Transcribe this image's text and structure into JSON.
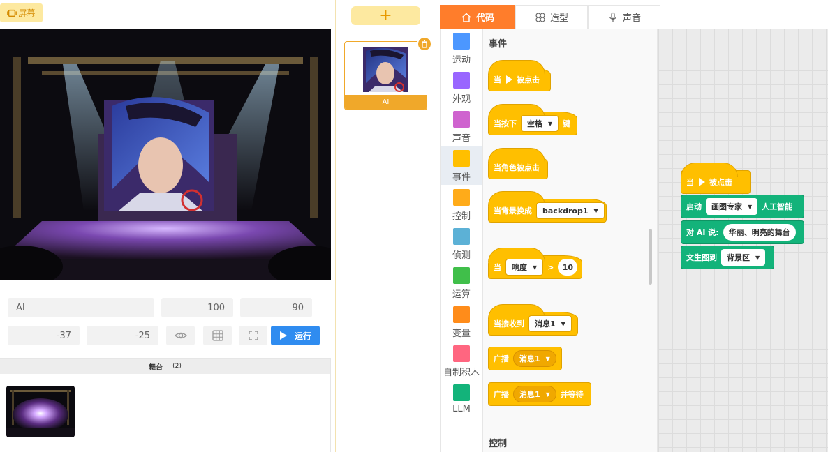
{
  "left": {
    "screen_label": "屏幕",
    "sprite_name_value": "AI",
    "size_value": "100",
    "direction_value": "90",
    "x_value": "-37",
    "y_value": "-25",
    "run_label": "运行",
    "stage_label": "舞台",
    "stage_count": "(2)"
  },
  "sprite": {
    "add_label": "+",
    "name": "AI"
  },
  "tabs": [
    {
      "label": "代码",
      "icon": "home-icon"
    },
    {
      "label": "造型",
      "icon": "costume-icon"
    },
    {
      "label": "声音",
      "icon": "microphone-icon"
    }
  ],
  "categories": [
    {
      "label": "运动",
      "color": "#4c97ff"
    },
    {
      "label": "外观",
      "color": "#9966ff"
    },
    {
      "label": "声音",
      "color": "#cf63cf"
    },
    {
      "label": "事件",
      "color": "#ffbf00"
    },
    {
      "label": "控制",
      "color": "#ffab19"
    },
    {
      "label": "侦测",
      "color": "#5cb1d6"
    },
    {
      "label": "运算",
      "color": "#40bf4a"
    },
    {
      "label": "变量",
      "color": "#ff8c1a"
    },
    {
      "label": "自制积木",
      "color": "#ff6680"
    },
    {
      "label": "LLM",
      "color": "#13b37a"
    }
  ],
  "palette": {
    "events_title": "事件",
    "control_title": "控制",
    "when_flag_a": "当",
    "when_flag_b": "被点击",
    "key_a": "当按下",
    "key_dd": "空格",
    "key_b": "键",
    "sprite_clicked": "当角色被点击",
    "backdrop_a": "当背景换成",
    "backdrop_dd": "backdrop1",
    "loud_a": "当",
    "loud_dd": "响度",
    "loud_op": ">",
    "loud_val": "10",
    "receive_a": "当接收到",
    "receive_dd": "消息1",
    "broadcast_a": "广播",
    "broadcast_dd": "消息1",
    "broadcast_wait_a": "广播",
    "broadcast_wait_dd": "消息1",
    "broadcast_wait_b": "并等待"
  },
  "workspace": {
    "hat_a": "当",
    "hat_b": "被点击",
    "start_a": "启动",
    "start_dd": "画图专家",
    "start_b": "人工智能",
    "say_a": "对 AI 说:",
    "say_val": "华丽、明亮的舞台",
    "t2i_a": "文生图到",
    "t2i_dd": "背景区"
  }
}
